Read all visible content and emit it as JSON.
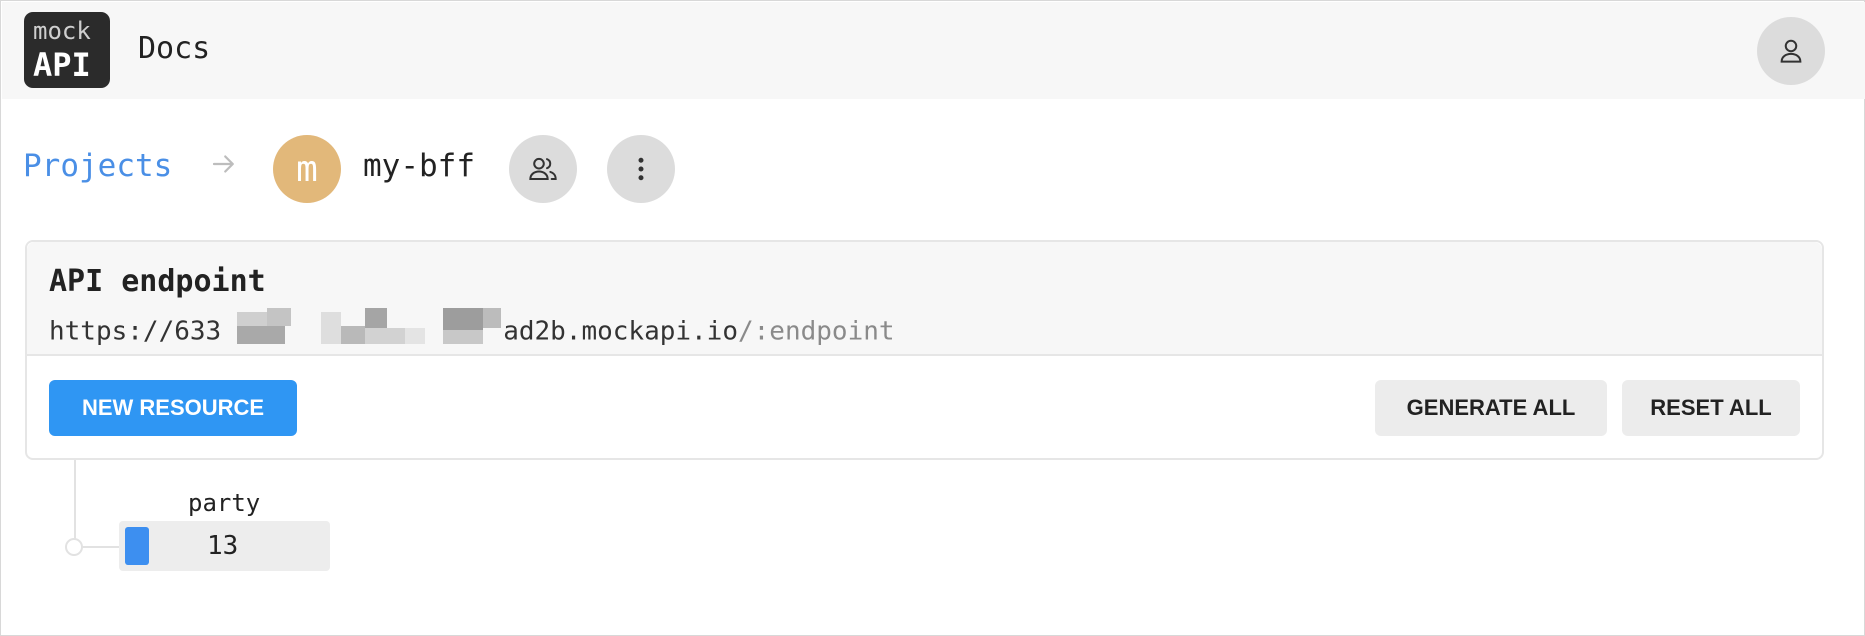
{
  "header": {
    "logo_line1": "mock",
    "logo_line2": "API",
    "docs_label": "Docs",
    "user_icon": "user-icon"
  },
  "breadcrumb": {
    "projects_label": "Projects",
    "arrow_icon": "arrow-right-icon",
    "project_avatar_letter": "m",
    "project_name": "my-bff",
    "members_icon": "users-icon",
    "more_icon": "more-vertical-icon"
  },
  "endpoint_card": {
    "title": "API endpoint",
    "url_prefix": "https://633",
    "url_suffix": "ad2b.mockapi.io",
    "url_path": "/:endpoint",
    "new_resource_label": "NEW RESOURCE",
    "generate_all_label": "GENERATE ALL",
    "reset_all_label": "RESET ALL"
  },
  "resources": [
    {
      "name": "party",
      "count": "13"
    }
  ],
  "colors": {
    "accent": "#2f96f3",
    "link": "#4a8fe6",
    "avatar": "#e2b87a"
  }
}
